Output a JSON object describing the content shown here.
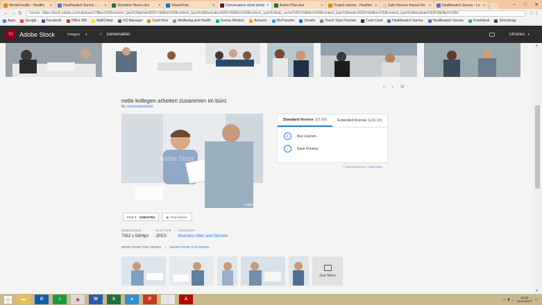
{
  "browser": {
    "tabs": [
      {
        "label": "Mental health - Healthc",
        "color": "#e08a00",
        "active": false
      },
      {
        "label": "Healthwatch Survey - Hea",
        "color": "#4a7bc8",
        "active": false
      },
      {
        "label": "Volunteer Hours.xlsx",
        "color": "#1e7145",
        "active": false
      },
      {
        "label": "SharePoint",
        "color": "#0078d4",
        "active": false
      },
      {
        "label": "Conversation stock photo",
        "color": "#88001b",
        "active": true
      },
      {
        "label": "Action Plan.xlsx",
        "color": "#1e7145",
        "active": false
      },
      {
        "label": "Project reports - Healthw",
        "color": "#e08a00",
        "active": false
      },
      {
        "label": "Safe-Havens-Impact-Re",
        "color": "#d0d0d0",
        "active": false
      },
      {
        "label": "Healthwatch Survey - Lo",
        "color": "#4a7bc8",
        "active": false
      }
    ],
    "secure_label": "Secure",
    "url": "https://stock.adobe.com/uk/search?filters%5Bcontent_type%3Aphoto%5D=1&filters%5Bcontent_type%3Aillustration%5D=0&filters%5Bcontent_type%3Azip_vector%5D=0&filters%5Bcontent_type%3Avideo%5D=0&filters%5Bcontent_type%3Atemplate%5D=0&filters%5Bc",
    "bookmarks": [
      {
        "label": "Apps",
        "color": "#4285f4"
      },
      {
        "label": "Google",
        "color": "#ea4335"
      },
      {
        "label": "Facebook",
        "color": "#3b5998"
      },
      {
        "label": "Office 365",
        "color": "#d83b01"
      },
      {
        "label": "MailChimp",
        "color": "#ffe01b"
      },
      {
        "label": "VQ Manager",
        "color": "#666666"
      },
      {
        "label": "Card Hero",
        "color": "#e08a00"
      },
      {
        "label": "Wellbeing and Health",
        "color": "#999999"
      },
      {
        "label": "Survey Monkey",
        "color": "#00bf6f"
      },
      {
        "label": "Amazon",
        "color": "#ff9900"
      },
      {
        "label": "WeTransfer",
        "color": "#409fff"
      },
      {
        "label": "Doodle",
        "color": "#1d6fe8"
      },
      {
        "label": "Touch Type Practise",
        "color": "#888888"
      },
      {
        "label": "Cash Card",
        "color": "#333333"
      },
      {
        "label": "Healthwatch Survey",
        "color": "#4a7bc8"
      },
      {
        "label": "Healthwatch Survey",
        "color": "#4a7bc8"
      },
      {
        "label": "Freshdesk",
        "color": "#25c16f"
      },
      {
        "label": "StockSnap",
        "color": "#444444"
      }
    ]
  },
  "stock": {
    "logo": "St",
    "brand": "Adobe Stock",
    "filter_label": "Images",
    "search_query": "conversation",
    "libraries_label": "Libraries"
  },
  "asset": {
    "title": "nette kollegen arbeiten zusammen im büro",
    "author_prefix": "By",
    "author": "contrastwerkstatt",
    "watermark": "Adobe Stock",
    "image_id": "#100647294",
    "file_label": "FILE #:",
    "file_number": "100647294",
    "find_similar": "Find Similar",
    "dimensions_key": "DIMENSIONS",
    "dimensions_value": "7952 x 5304px",
    "file_type_key": "FILE TYPE",
    "file_type_value": "JPEG",
    "category_key": "CATEGORY",
    "category_value": "Business Men and Women",
    "more_series": "MORE FROM THIS SERIES",
    "separator": "|",
    "more_model": "MORE FROM THIS MODEL",
    "see_more": "See More"
  },
  "license": {
    "standard_label": "Standard license",
    "standard_price": "(£5.99)",
    "extended_label": "Extended license",
    "extended_price": "(£49.99)",
    "buy_label": "Buy License...",
    "save_label": "Save Preview",
    "footer_prefix": "Standard license",
    "footer_separator": "|",
    "footer_link": "Learn more"
  },
  "taskbar": {
    "time": "15:32",
    "date": "12/11/2017"
  }
}
